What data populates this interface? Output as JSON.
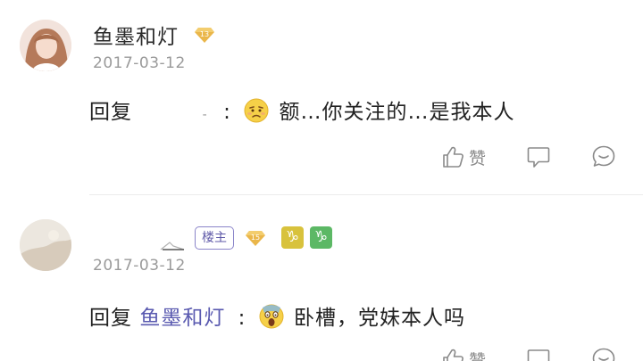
{
  "comments": [
    {
      "username": "鱼墨和灯",
      "level": "13",
      "date": "2017-03-12",
      "reply_prefix": "回复",
      "reply_target": "",
      "colon": ":",
      "emoji": "grimace-emoji",
      "text": "额…你关注的…是我本人",
      "actions": {
        "like_label": "赞"
      }
    },
    {
      "username": "",
      "owner_badge": "楼主",
      "level": "15",
      "zodiac": [
        "♑",
        "♑"
      ],
      "date": "2017-03-12",
      "reply_prefix": "回复",
      "reply_target": "鱼墨和灯",
      "colon": ":",
      "emoji": "shocked-emoji",
      "text": "卧槽，党妹本人吗",
      "actions": {
        "like_label": "赞"
      }
    }
  ],
  "colors": {
    "link": "#5a5ab0",
    "muted": "#9a9a9a",
    "level_badge": "#e9b84a",
    "owner_badge_border": "#8a84c9"
  }
}
